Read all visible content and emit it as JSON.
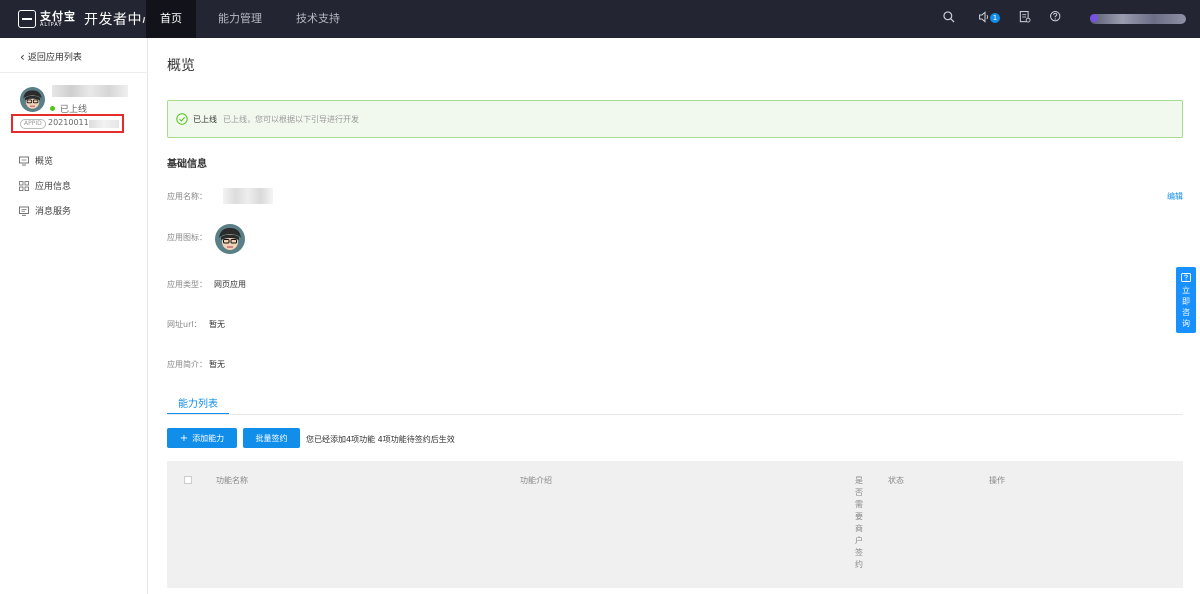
{
  "topbar": {
    "brand_cn": "支付宝",
    "brand_en": "ALIPAY",
    "title": "开发者中心",
    "nav": [
      {
        "label": "首页",
        "active": true
      },
      {
        "label": "能力管理",
        "active": false
      },
      {
        "label": "技术支持",
        "active": false
      }
    ],
    "notification_count": "1",
    "icons": [
      "search-icon",
      "speaker-icon",
      "document-icon",
      "help-icon"
    ]
  },
  "sidebar": {
    "back_label": "返回应用列表",
    "status": "已上线",
    "appid_tag": "APPID",
    "appid_value": "20210011",
    "menu": [
      {
        "label": "概览",
        "icon": "monitor-icon"
      },
      {
        "label": "应用信息",
        "icon": "grid-icon"
      },
      {
        "label": "消息服务",
        "icon": "message-icon"
      }
    ]
  },
  "main": {
    "title": "概览",
    "alert": {
      "title": "已上线",
      "description": "已上线，您可以根据以下引导进行开发"
    },
    "basic_info_title": "基础信息",
    "edit_label": "编辑",
    "fields": {
      "app_name_label": "应用名称：",
      "app_icon_label": "应用图标：",
      "app_type_label": "应用类型：",
      "app_type_value": "网页应用",
      "url_label": "网址url：",
      "url_value": "暂无",
      "intro_label": "应用简介：",
      "intro_value": "暂无"
    },
    "tab_label": "能力列表",
    "add_button": "添加能力",
    "sign_button": "批量签约",
    "count_text": "您已经添加4项功能   4项功能待签约后生效",
    "table": {
      "columns": [
        "功能名称",
        "功能介绍",
        "是否需要商户签约",
        "状态",
        "操作"
      ]
    }
  },
  "float": {
    "consult_label": "立即咨询"
  },
  "colors": {
    "primary": "#108ee9",
    "topbar": "#232532",
    "success": "#52c41a",
    "highlight_border": "#e62b2b"
  }
}
